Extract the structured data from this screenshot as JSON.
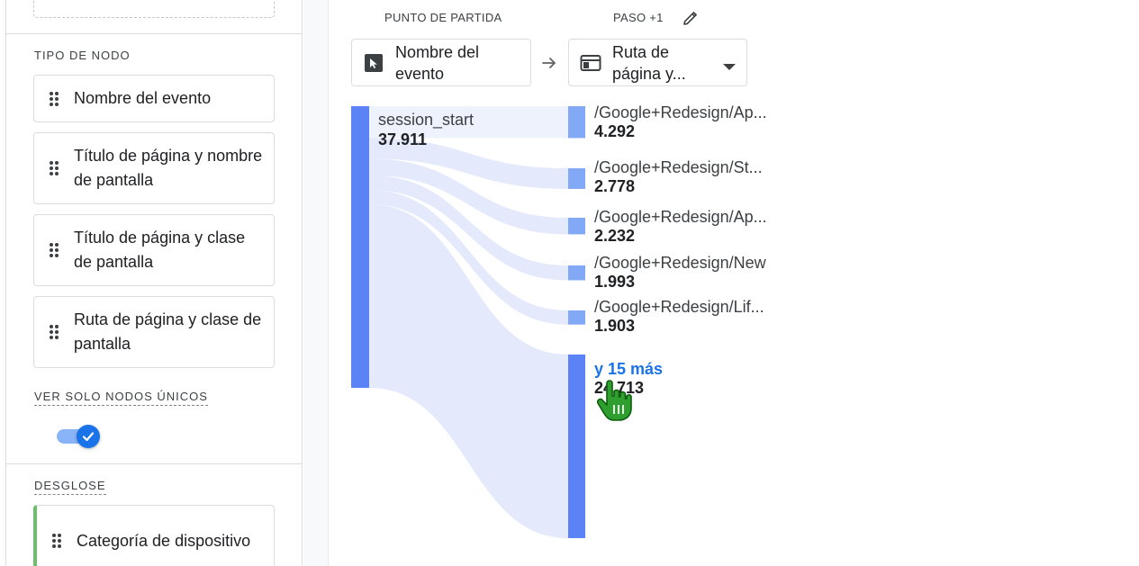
{
  "left_panel": {
    "node_type_label": "TIPO DE NODO",
    "node_types": [
      {
        "label": "Nombre del evento"
      },
      {
        "label": "Título de página y nombre de pantalla"
      },
      {
        "label": "Título de página y clase de pantalla"
      },
      {
        "label": "Ruta de página y clase de pantalla"
      }
    ],
    "unique_nodes_label": "VER SOLO NODOS ÚNICOS",
    "unique_nodes_enabled": true,
    "breakdown_label": "DESGLOSE",
    "breakdown_item": {
      "label": "Categoría de dispositivo"
    }
  },
  "header": {
    "start_point_label": "PUNTO DE PARTIDA",
    "step_label": "PASO +1",
    "start_dimension": "Nombre del evento",
    "step_dimension": "Ruta de página y..."
  },
  "flow": {
    "source": {
      "label": "session_start",
      "value": "37.911",
      "value_num": 37911
    },
    "targets": [
      {
        "label": "/Google+Redesign/Ap...",
        "value": "4.292",
        "value_num": 4292
      },
      {
        "label": "/Google+Redesign/St...",
        "value": "2.778",
        "value_num": 2778
      },
      {
        "label": "/Google+Redesign/Ap...",
        "value": "2.232",
        "value_num": 2232
      },
      {
        "label": "/Google+Redesign/New",
        "value": "1.993",
        "value_num": 1993
      },
      {
        "label": "/Google+Redesign/Lif...",
        "value": "1.903",
        "value_num": 1903
      }
    ],
    "more": {
      "label": "y 15 más",
      "value": "24.713",
      "value_num": 24713
    }
  },
  "colors": {
    "source_bar": "#5b83f6",
    "target_bar": "#82a9f5",
    "more_bar": "#5b83f6",
    "link": "#e4e9fb",
    "link_top": "#eef2fc",
    "accent": "#1a73e8",
    "breakdown_accent": "#6cc06b"
  },
  "icons": {
    "pencil": "pencil-icon",
    "cursor_box": "cursor-box-icon",
    "web_page": "web-page-icon",
    "dropdown": "chevron-down-icon",
    "arrow": "arrow-right-icon",
    "grip": "drag-handle-icon",
    "check": "check-icon",
    "hand": "hand-cursor-icon"
  }
}
